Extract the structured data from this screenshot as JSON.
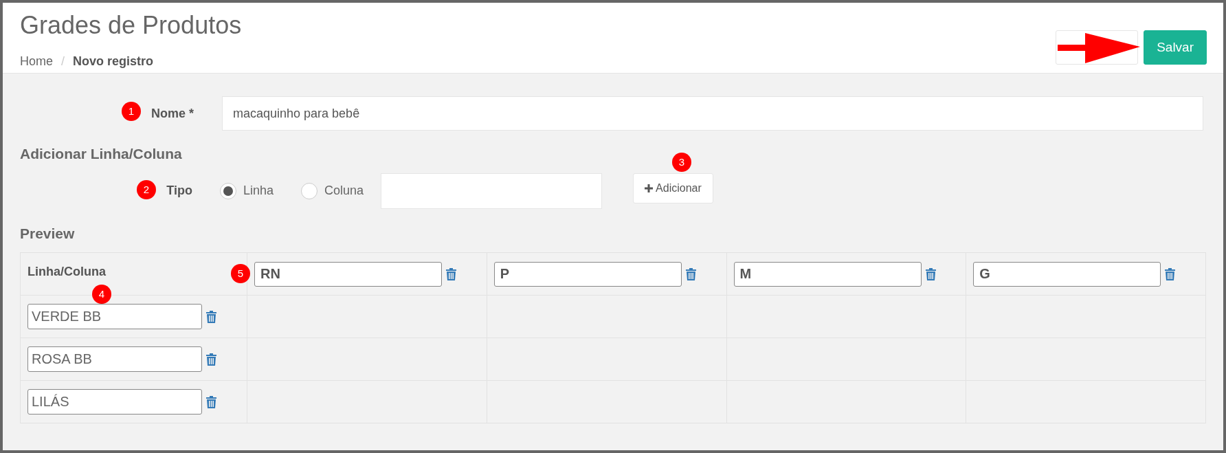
{
  "title": "Grades de Produtos",
  "breadcrumb": [
    {
      "label": "Home",
      "current": false
    },
    {
      "label": "Novo registro",
      "current": true
    }
  ],
  "breadcrumb_separator": "/",
  "actions": [
    {
      "kind": "default"
    },
    {
      "label": "Salvar",
      "kind": "primary"
    }
  ],
  "nome": {
    "label": "Nome *",
    "value": "macaquinho para bebê"
  },
  "section_heading": "Adicionar Linha/Coluna",
  "tipo": {
    "label": "Tipo",
    "options": [
      {
        "label": "Linha",
        "selected": true
      },
      {
        "label": "Coluna",
        "selected": false
      }
    ],
    "add_button": "Adicionar"
  },
  "preview_heading": "Preview",
  "table": {
    "corner": "Linha/Coluna",
    "columns": [
      "RN",
      "P",
      "M",
      "G"
    ],
    "rows": [
      "VERDE BB",
      "ROSA BB",
      "LILÁS"
    ]
  },
  "annotations": [
    "1",
    "2",
    "3",
    "4",
    "5"
  ]
}
